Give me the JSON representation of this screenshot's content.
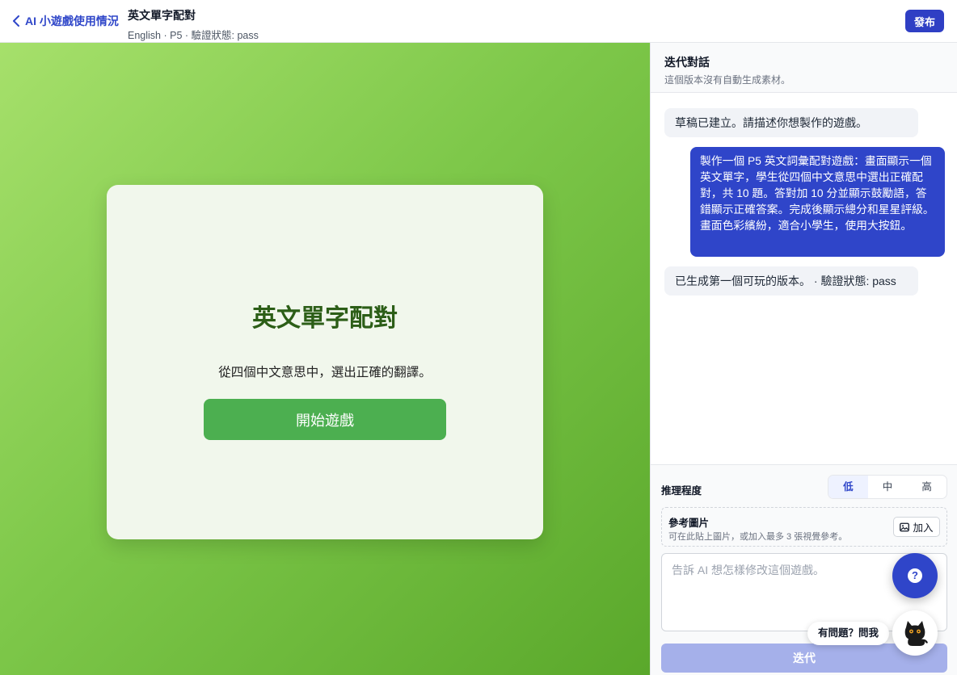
{
  "header": {
    "back_label": "AI 小遊戲使用情況",
    "title": "英文單字配對",
    "subtitle": "English · P5 · 驗證狀態: pass",
    "publish_label": "發布"
  },
  "game": {
    "title": "英文單字配對",
    "description": "從四個中文意思中，選出正確的翻譯。",
    "start_label": "開始遊戲"
  },
  "panel": {
    "title": "迭代對話",
    "subtitle": "這個版本沒有自動生成素材。",
    "messages": [
      {
        "role": "system",
        "text": "草稿已建立。請描述你想製作的遊戲。"
      },
      {
        "role": "user",
        "text": "製作一個 P5 英文詞彙配對遊戲：畫面顯示一個英文單字，學生從四個中文意思中選出正確配對，共 10 題。答對加 10 分並顯示鼓勵語，答錯顯示正確答案。完成後顯示總分和星星評級。畫面色彩繽紛，適合小學生，使用大按鈕。"
      },
      {
        "role": "system",
        "text": "已生成第一個可玩的版本。 · 驗證狀態: pass"
      }
    ],
    "effort": {
      "label": "推理程度",
      "options": [
        "低",
        "中",
        "高"
      ],
      "selected": "低"
    },
    "reference": {
      "title": "參考圖片",
      "hint": "可在此貼上圖片，或加入最多 3 張視覺參考。",
      "add_label": "加入"
    },
    "input_placeholder": "告訴 AI 想怎樣修改這個遊戲。",
    "iterate_label": "迭代"
  },
  "help": {
    "fab_icon": "?",
    "ask_label": "有問題？問我"
  },
  "colors": {
    "accent": "#2f45c9",
    "game_green": "#4caf50",
    "title_green": "#2c5e17"
  }
}
